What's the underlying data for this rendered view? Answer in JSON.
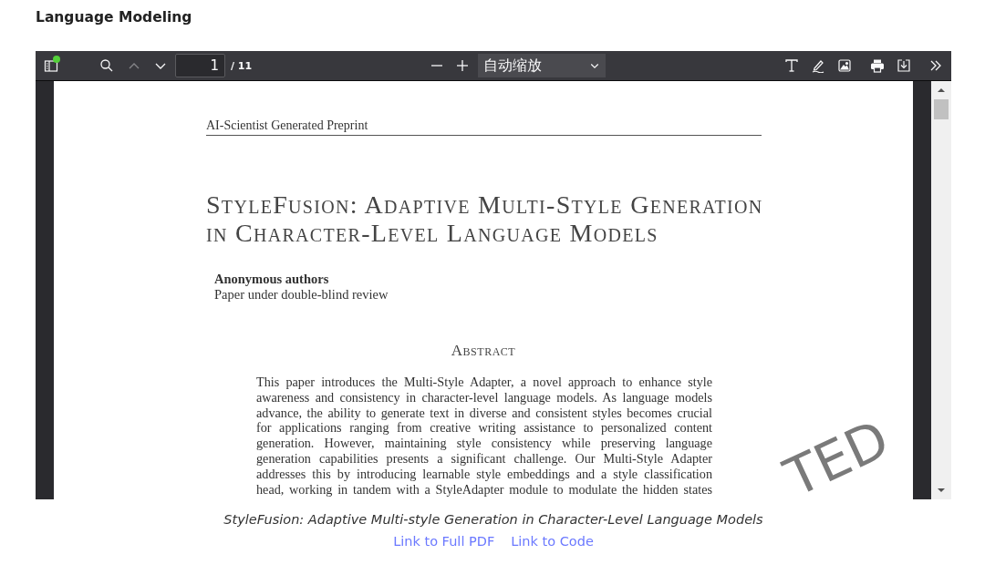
{
  "section_title": "Language Modeling",
  "viewer": {
    "toolbar": {
      "sidebar_badge": true,
      "previous_disabled": true,
      "next_disabled": false,
      "page_number": "1",
      "page_count": "/ 11",
      "zoom": "自动缩放"
    },
    "page": {
      "running_header": "AI-Scientist Generated Preprint",
      "title_lines": [
        "StyleFusion: Adaptive Multi-Style Generation",
        "in Character-Level Language Models"
      ],
      "authors": "Anonymous authors",
      "affiliation": "Paper under double-blind review",
      "abstract_heading": "Abstract",
      "abstract_lines": [
        "This paper introduces the Multi-Style Adapter, a novel approach to enhance style",
        "awareness and consistency in character-level language models. As language models",
        "advance, the ability to generate text in diverse and consistent styles becomes crucial",
        "for applications ranging from creative writing assistance to personalized content",
        "generation. However, maintaining style consistency while preserving language",
        "generation capabilities presents a significant challenge. Our Multi-Style Adapter",
        "addresses this by introducing learnable style embeddings and a style classification",
        "head, working in tandem with a StyleAdapter module to modulate the hidden states"
      ],
      "stamp": "TED"
    }
  },
  "caption": "StyleFusion: Adaptive Multi-style Generation in Character-Level Language Models",
  "links": [
    "Link to Full PDF",
    "Link to Code"
  ]
}
